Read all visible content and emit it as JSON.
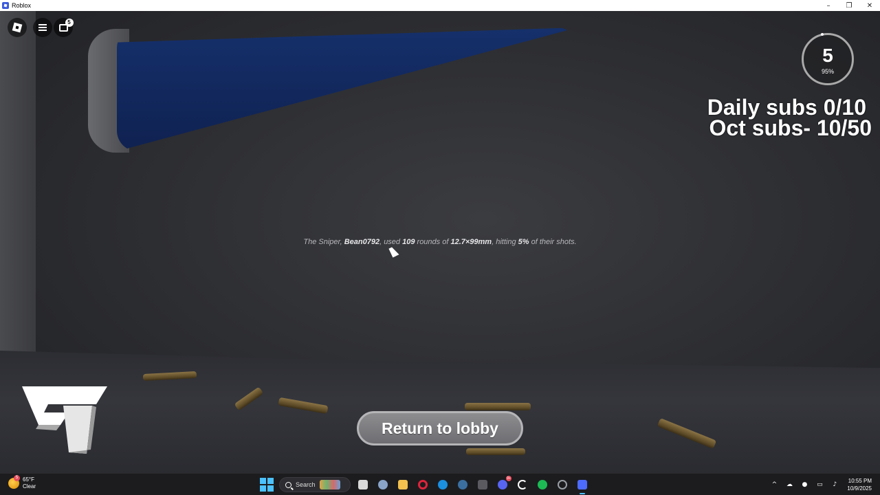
{
  "window": {
    "title": "Roblox",
    "minimize": "–",
    "maximize": "❐",
    "close": "✕"
  },
  "hud": {
    "chat_badge_count": "5"
  },
  "overlay": {
    "counter_value": "5",
    "counter_percent": "95%",
    "daily_subs": "Daily subs 0/10",
    "oct_subs": "Oct subs- 10/50"
  },
  "message": {
    "prefix": "The Sniper, ",
    "player": "Bean0792",
    "mid1": ", used ",
    "rounds": "109",
    "mid2": " rounds of ",
    "caliber": "12.7×99mm",
    "mid3": ", hitting ",
    "hit_pct": "5%",
    "suffix": " of their shots."
  },
  "return_button": {
    "label": "Return to lobby"
  },
  "taskbar": {
    "weather_temp": "65°F",
    "weather_desc": "Clear",
    "weather_badge": "5",
    "search_label": "Search",
    "discord_badge": "9+",
    "time": "10:55 PM",
    "date": "10/9/2025",
    "apps": [
      {
        "name": "task-view-icon",
        "color": "#d9d9d9"
      },
      {
        "name": "settings-icon",
        "color": "#8aa4c8"
      },
      {
        "name": "file-explorer-icon",
        "color": "#f2c14e"
      },
      {
        "name": "opera-icon",
        "color": "#e0243b"
      },
      {
        "name": "edge-icon",
        "color": "#1b8fe0"
      },
      {
        "name": "steam-icon",
        "color": "#3b6fa0"
      },
      {
        "name": "davinci-icon",
        "color": "#5a5a60"
      },
      {
        "name": "discord-icon",
        "color": "#5865f2"
      },
      {
        "name": "app-c-icon",
        "color": "#ffffff"
      },
      {
        "name": "spotify-icon",
        "color": "#1db954"
      },
      {
        "name": "chrome-icon",
        "color": "#9aa0a6"
      },
      {
        "name": "roblox-icon",
        "color": "#4d6bff"
      }
    ]
  }
}
